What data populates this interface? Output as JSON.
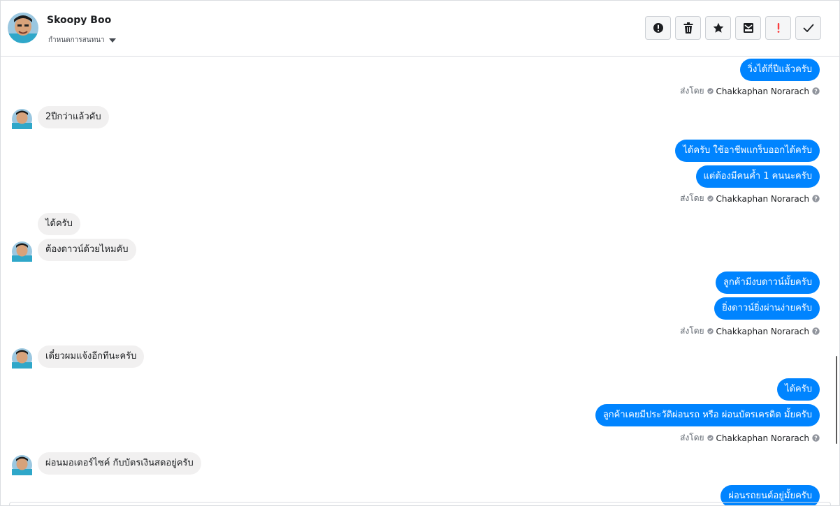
{
  "header": {
    "name": "Skoopy Boo",
    "assign_label": "กำหนดการสนทนา",
    "toolbar": [
      {
        "id": "spam",
        "icon": "alert-circle-icon"
      },
      {
        "id": "delete",
        "icon": "trash-icon"
      },
      {
        "id": "star",
        "icon": "star-icon"
      },
      {
        "id": "unread",
        "icon": "mark-unread-icon"
      },
      {
        "id": "important",
        "icon": "exclamation-icon"
      },
      {
        "id": "done",
        "icon": "check-icon"
      }
    ]
  },
  "colors": {
    "outgoing_bubble": "#0084ff",
    "incoming_bubble": "#f1f0f0",
    "important_icon": "#fa3e3e"
  },
  "sent_by": {
    "prefix": "ส่งโดย",
    "agent": "Chakkaphan Norarach"
  },
  "messages": [
    {
      "dir": "out",
      "text": "วิ่งได้กี่ปีแล้วครับ"
    },
    {
      "dir": "in",
      "text": "2ปีกว่าแล้วคับ"
    },
    {
      "dir": "out",
      "text": "ได้ครับ ใช้อาชีพแกร็บออกได้ครับ"
    },
    {
      "dir": "out",
      "text": "แต่ต้องมีคนค้ำ 1 คนนะครับ"
    },
    {
      "dir": "in",
      "text": "ได้ครับ"
    },
    {
      "dir": "in",
      "text": "ต้องดาวน์ด้วยไหมคับ"
    },
    {
      "dir": "out",
      "text": "ลูกค้ามีงบดาวน์มั้ยครับ"
    },
    {
      "dir": "out",
      "text": "ยิ่งดาวน์ยิ่งผ่านง่ายครับ"
    },
    {
      "dir": "in",
      "text": "เดี๋ยวผมแจ้งอีกทีนะครับ"
    },
    {
      "dir": "out",
      "text": "ได้ครับ"
    },
    {
      "dir": "out",
      "text": "ลูกค้าเคยมีประวัติผ่อนรถ หรือ ผ่อนบัตรเครดิต มั้ยครับ"
    },
    {
      "dir": "in",
      "text": "ผ่อนมอเตอร์ไซค์ กับบัตรเงินสดอยู่ครับ"
    },
    {
      "dir": "out",
      "text": "ผ่อนรถยนต์อยู่มั้ยครับ"
    }
  ]
}
